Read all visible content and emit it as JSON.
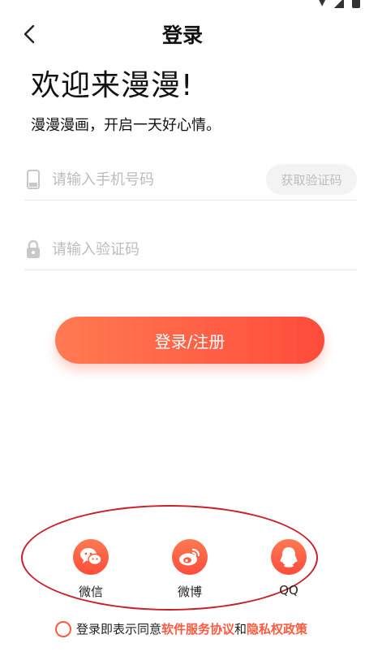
{
  "nav": {
    "title": "登录"
  },
  "welcome": {
    "title": "欢迎来漫漫!",
    "subtitle": "漫漫漫画，开启一天好心情。"
  },
  "phone_field": {
    "placeholder": "请输入手机号码",
    "value": "",
    "icon": "phone-icon"
  },
  "code_field": {
    "placeholder": "请输入验证码",
    "value": "",
    "icon": "lock-icon"
  },
  "get_code_button": {
    "label": "获取验证码"
  },
  "login_button": {
    "label": "登录/注册"
  },
  "social_login": [
    {
      "label": "微信",
      "icon": "wechat-icon"
    },
    {
      "label": "微博",
      "icon": "weibo-icon"
    },
    {
      "label": "QQ",
      "icon": "qq-icon"
    }
  ],
  "agreement": {
    "prefix": "登录即表示同意",
    "terms_link": "软件服务协议",
    "conjunction": "和",
    "privacy_link": "隐私权政策"
  },
  "colors": {
    "accent": "#ff5a3f",
    "accent_gradient_start": "#ff7a52",
    "accent_gradient_end": "#ff4c3b",
    "annotation": "#c8202a",
    "placeholder": "#bcbcbc",
    "divider": "#e8e8e8"
  }
}
